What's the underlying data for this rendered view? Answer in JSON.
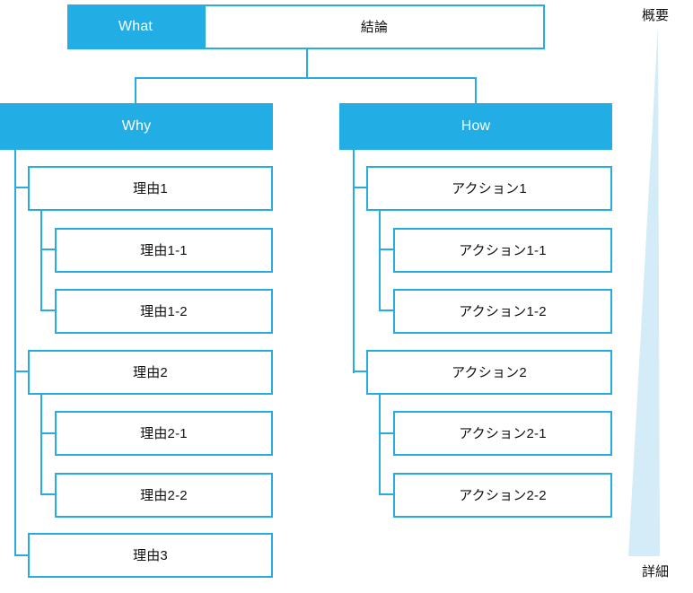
{
  "diagram": {
    "title_row": {
      "label_box": "What",
      "content_box": "結論"
    },
    "branches": [
      {
        "key": "why",
        "header": "Why",
        "items": [
          {
            "label": "理由1",
            "level": 2
          },
          {
            "label": "理由1-1",
            "level": 3
          },
          {
            "label": "理由1-2",
            "level": 3
          },
          {
            "label": "理由2",
            "level": 2
          },
          {
            "label": "理由2-1",
            "level": 3
          },
          {
            "label": "理由2-2",
            "level": 3
          },
          {
            "label": "理由3",
            "level": 2
          }
        ]
      },
      {
        "key": "how",
        "header": "How",
        "items": [
          {
            "label": "アクション1",
            "level": 2
          },
          {
            "label": "アクション1-1",
            "level": 3
          },
          {
            "label": "アクション1-2",
            "level": 3
          },
          {
            "label": "アクション2",
            "level": 2
          },
          {
            "label": "アクション2-1",
            "level": 3
          },
          {
            "label": "アクション2-2",
            "level": 3
          }
        ]
      }
    ],
    "scale_axis": {
      "top_label": "概要",
      "bottom_label": "詳細"
    },
    "colors": {
      "accent": "#22AEE5",
      "border": "#29ABE2",
      "triangle_fill": "#D3ECF7",
      "text": "#111111",
      "inverse_text": "#FFFFFF",
      "background": "#FFFFFF"
    }
  }
}
